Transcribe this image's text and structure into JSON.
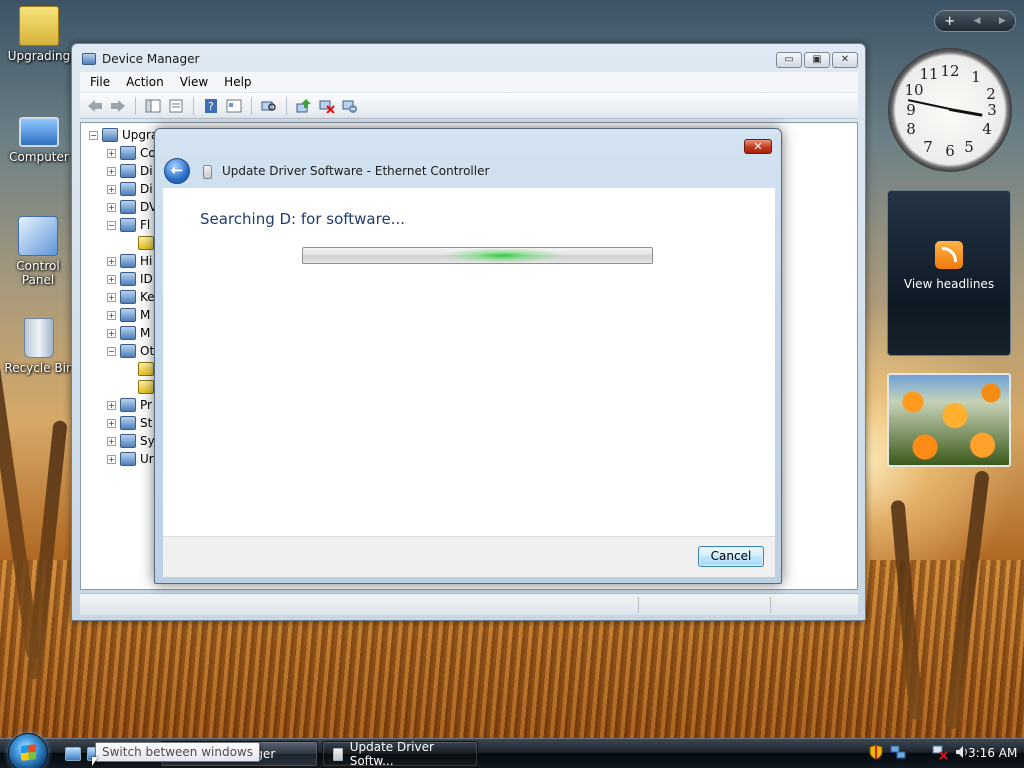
{
  "desktop": {
    "icons": [
      {
        "label": "Upgrading",
        "icon": "folder-icon"
      },
      {
        "label": "Computer",
        "icon": "computer-icon"
      },
      {
        "label": "Control Panel",
        "icon": "control-panel-icon"
      },
      {
        "label": "Recycle Bin",
        "icon": "recycle-bin-icon"
      }
    ]
  },
  "sidebar": {
    "add_symbol": "+",
    "prev_symbol": "◀",
    "next_symbol": "▶",
    "clock_numbers": [
      "12",
      "1",
      "2",
      "3",
      "4",
      "5",
      "6",
      "7",
      "8",
      "9",
      "10",
      "11"
    ],
    "feeds_label": "View headlines"
  },
  "device_manager": {
    "title": "Device Manager",
    "minimize": "▭",
    "maximize": "▣",
    "close": "✕",
    "menu": [
      "File",
      "Action",
      "View",
      "Help"
    ],
    "toolbar_icons": [
      "back-arrow-icon",
      "forward-arrow-icon",
      "show-hide-tree-icon",
      "properties-icon",
      "help-icon",
      "view-icon",
      "scan-hardware-icon",
      "update-driver-icon",
      "uninstall-icon",
      "disable-icon"
    ],
    "tree": [
      {
        "label": "Upgra",
        "expander": "−",
        "indent": 0,
        "warn": false
      },
      {
        "label": "Co",
        "expander": "+",
        "indent": 1,
        "warn": false
      },
      {
        "label": "Di",
        "expander": "+",
        "indent": 1,
        "warn": false
      },
      {
        "label": "Di",
        "expander": "+",
        "indent": 1,
        "warn": false
      },
      {
        "label": "DV",
        "expander": "+",
        "indent": 1,
        "warn": false
      },
      {
        "label": "Fl",
        "expander": "−",
        "indent": 1,
        "warn": false
      },
      {
        "label": "",
        "expander": "",
        "indent": 2,
        "warn": true
      },
      {
        "label": "Hi",
        "expander": "+",
        "indent": 1,
        "warn": false
      },
      {
        "label": "ID",
        "expander": "+",
        "indent": 1,
        "warn": false
      },
      {
        "label": "Ke",
        "expander": "+",
        "indent": 1,
        "warn": false
      },
      {
        "label": "M",
        "expander": "+",
        "indent": 1,
        "warn": false
      },
      {
        "label": "M",
        "expander": "+",
        "indent": 1,
        "warn": false
      },
      {
        "label": "Ot",
        "expander": "−",
        "indent": 1,
        "warn": false
      },
      {
        "label": "",
        "expander": "",
        "indent": 2,
        "warn": true
      },
      {
        "label": "",
        "expander": "",
        "indent": 2,
        "warn": true
      },
      {
        "label": "Pr",
        "expander": "+",
        "indent": 1,
        "warn": false
      },
      {
        "label": "St",
        "expander": "+",
        "indent": 1,
        "warn": false
      },
      {
        "label": "Sy",
        "expander": "+",
        "indent": 1,
        "warn": false
      },
      {
        "label": "Ur",
        "expander": "+",
        "indent": 1,
        "warn": false
      }
    ]
  },
  "dialog": {
    "close_symbol": "✕",
    "back_symbol": "←",
    "title": "Update Driver Software - Ethernet Controller",
    "heading": "Searching D: for software...",
    "cancel_label": "Cancel"
  },
  "taskbar": {
    "tooltip": "Switch between windows",
    "tasks": [
      {
        "label": "anager",
        "active": false
      },
      {
        "label": "Update Driver Softw...",
        "active": true
      }
    ],
    "clock": "3:16 AM",
    "tray_icons": [
      "security-shield-icon",
      "network-icon",
      "network-disconnected-icon",
      "volume-icon"
    ]
  }
}
